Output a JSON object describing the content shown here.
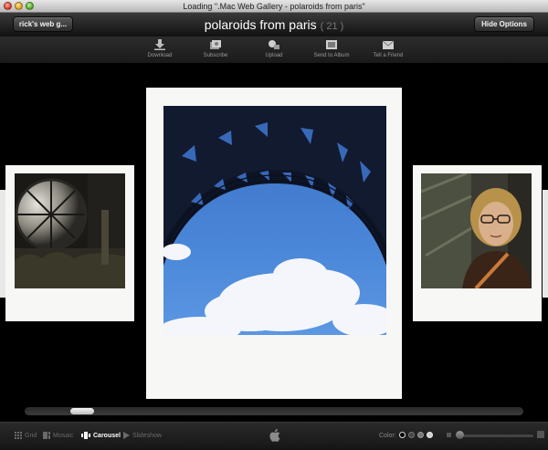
{
  "window": {
    "title": "Loading \".Mac Web Gallery - polaroids from paris\""
  },
  "header": {
    "back_label": "rick's web g...",
    "album_title": "polaroids from paris",
    "album_count": "( 21 )",
    "hide_label": "Hide Options"
  },
  "toolbar": {
    "items": [
      {
        "label": "Download",
        "icon": "download-icon"
      },
      {
        "label": "Subscribe",
        "icon": "subscribe-icon"
      },
      {
        "label": "Upload",
        "icon": "upload-icon"
      },
      {
        "label": "Send to Album",
        "icon": "send-to-album-icon"
      },
      {
        "label": "Tell a Friend",
        "icon": "envelope-icon"
      }
    ]
  },
  "carousel": {
    "photos": [
      {
        "subject": "clock window interior",
        "position": "left"
      },
      {
        "subject": "eiffel tower arch with sky",
        "position": "center"
      },
      {
        "subject": "woman with glasses",
        "position": "right"
      }
    ]
  },
  "scrollbar": {
    "position_fraction": 0.1
  },
  "footer": {
    "views": [
      {
        "label": "Grid",
        "icon": "grid-icon",
        "active": false
      },
      {
        "label": "Mosaic",
        "icon": "mosaic-icon",
        "active": false
      },
      {
        "label": "Carousel",
        "icon": "carousel-icon",
        "active": true
      },
      {
        "label": "Slideshow",
        "icon": "play-icon",
        "active": false
      }
    ],
    "color_label": "Color:",
    "colors": [
      "#000000",
      "#444444",
      "#777777",
      "#cfcfcf"
    ],
    "selected_color": "#000000",
    "size_fraction": 0.05
  }
}
